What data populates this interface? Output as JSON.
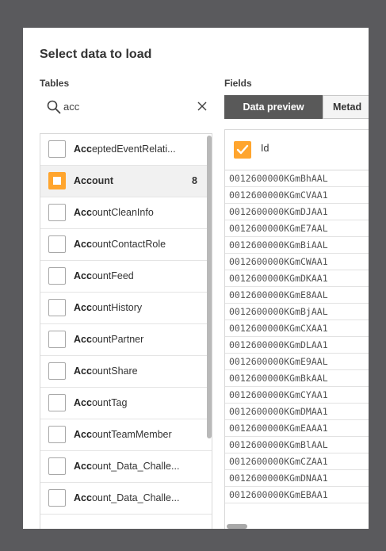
{
  "dialog": {
    "title": "Select data to load",
    "tables_label": "Tables",
    "fields_label": "Fields"
  },
  "search": {
    "value": "acc",
    "query_bold": "Acc"
  },
  "tables": [
    {
      "rest": "eptedEventRelati...",
      "selected": false,
      "count": ""
    },
    {
      "rest": "ount",
      "selected": true,
      "count": "8"
    },
    {
      "rest": "ountCleanInfo",
      "selected": false,
      "count": ""
    },
    {
      "rest": "ountContactRole",
      "selected": false,
      "count": ""
    },
    {
      "rest": "ountFeed",
      "selected": false,
      "count": ""
    },
    {
      "rest": "ountHistory",
      "selected": false,
      "count": ""
    },
    {
      "rest": "ountPartner",
      "selected": false,
      "count": ""
    },
    {
      "rest": "ountShare",
      "selected": false,
      "count": ""
    },
    {
      "rest": "ountTag",
      "selected": false,
      "count": ""
    },
    {
      "rest": "ountTeamMember",
      "selected": false,
      "count": ""
    },
    {
      "rest": "ount_Data_Challe...",
      "selected": false,
      "count": ""
    },
    {
      "rest": "ount_Data_Challe...",
      "selected": false,
      "count": ""
    }
  ],
  "tabs": {
    "preview": "Data preview",
    "metadata": "Metad"
  },
  "preview": {
    "column": "Id",
    "rows": [
      "0012600000KGmBhAAL",
      "0012600000KGmCVAA1",
      "0012600000KGmDJAA1",
      "0012600000KGmE7AAL",
      "0012600000KGmBiAAL",
      "0012600000KGmCWAA1",
      "0012600000KGmDKAA1",
      "0012600000KGmE8AAL",
      "0012600000KGmBjAAL",
      "0012600000KGmCXAA1",
      "0012600000KGmDLAA1",
      "0012600000KGmE9AAL",
      "0012600000KGmBkAAL",
      "0012600000KGmCYAA1",
      "0012600000KGmDMAA1",
      "0012600000KGmEAAA1",
      "0012600000KGmBlAAL",
      "0012600000KGmCZAA1",
      "0012600000KGmDNAA1",
      "0012600000KGmEBAA1"
    ]
  },
  "colors": {
    "accent": "#ffa52e",
    "active_tab": "#595959"
  }
}
